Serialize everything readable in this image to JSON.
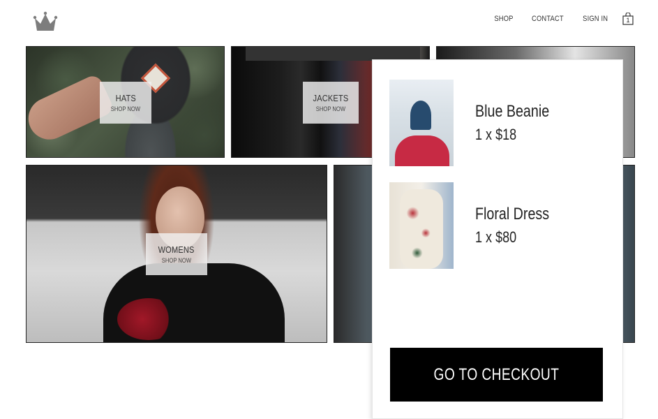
{
  "header": {
    "logo": "crown-logo",
    "nav": [
      {
        "label": "SHOP"
      },
      {
        "label": "CONTACT"
      },
      {
        "label": "SIGN IN"
      }
    ],
    "cart_icon": "shopping-bag-icon",
    "cart_count": "1"
  },
  "tiles": [
    {
      "title": "HATS",
      "subtitle": "SHOP NOW"
    },
    {
      "title": "JACKETS",
      "subtitle": "SHOP NOW"
    },
    {
      "title": "WOMENS",
      "subtitle": "SHOP NOW"
    }
  ],
  "cart": {
    "items": [
      {
        "name": "Blue Beanie",
        "quantity_price": "1 x $18"
      },
      {
        "name": "Floral Dress",
        "quantity_price": "1 x $80"
      }
    ],
    "checkout_label": "GO TO CHECKOUT"
  },
  "colors": {
    "checkout_bg": "#000000",
    "checkout_text": "#ffffff",
    "logo": "#808080"
  }
}
